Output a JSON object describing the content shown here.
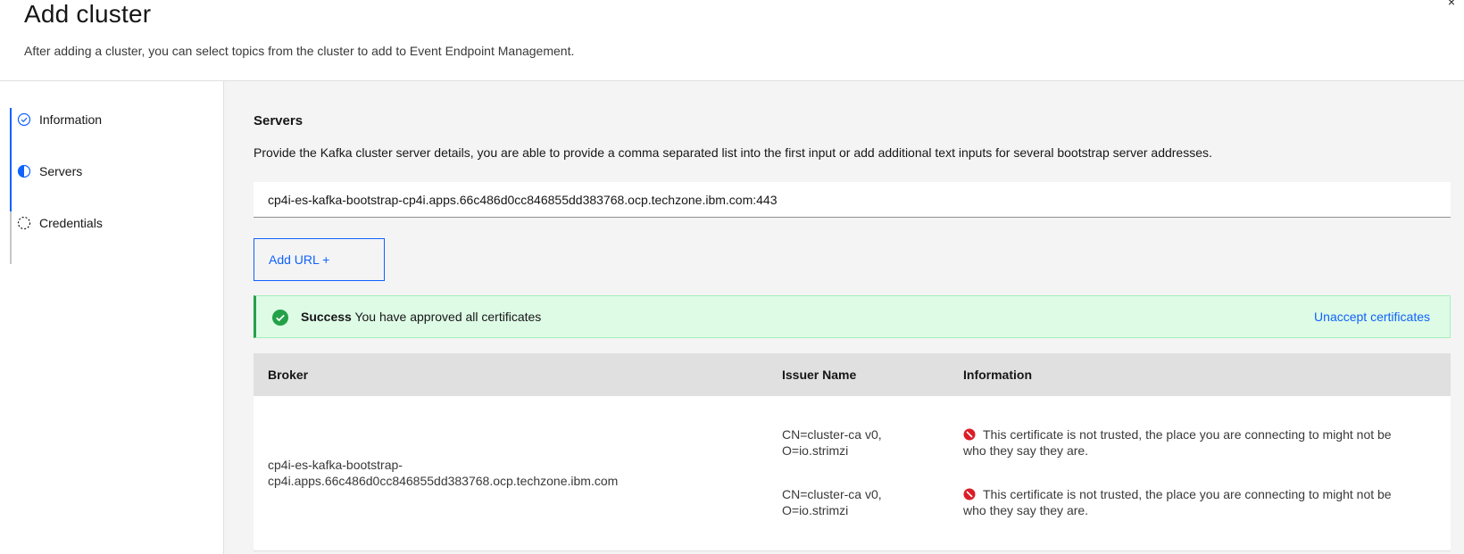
{
  "header": {
    "title": "Add cluster",
    "subtitle": "After adding a cluster, you can select topics from the cluster to add to Event Endpoint Management.",
    "close_symbol": "×"
  },
  "sidebar": {
    "steps": [
      {
        "label": "Information",
        "status": "complete",
        "icon": "checkmark-outline-icon"
      },
      {
        "label": "Servers",
        "status": "current",
        "icon": "incomplete-half-icon"
      },
      {
        "label": "Credentials",
        "status": "incomplete",
        "icon": "dashed-circle-icon"
      }
    ]
  },
  "servers": {
    "title": "Servers",
    "description": "Provide the Kafka cluster server details, you are able to provide a comma separated list into the first input or add additional text inputs for several bootstrap server addresses.",
    "url_value": "cp4i-es-kafka-bootstrap-cp4i.apps.66c486d0cc846855dd383768.ocp.techzone.ibm.com:443",
    "add_url_label": "Add URL +"
  },
  "notification": {
    "kind": "success",
    "title": "Success",
    "message": "You have approved all certificates",
    "action": "Unaccept certificates"
  },
  "table": {
    "headers": [
      "Broker",
      "Issuer Name",
      "Information"
    ],
    "rows": [
      {
        "broker_line1": "cp4i-es-kafka-bootstrap-",
        "broker_line2": "cp4i.apps.66c486d0cc846855dd383768.ocp.techzone.ibm.com",
        "certificates": [
          {
            "issuer_line1": "CN=cluster-ca v0,",
            "issuer_line2": "O=io.strimzi",
            "info_line1": "This certificate is not trusted, the place you are connecting to might not be",
            "info_line2": "who they say they are."
          },
          {
            "issuer_line1": "CN=cluster-ca v0,",
            "issuer_line2": "O=io.strimzi",
            "info_line1": "This certificate is not trusted, the place you are connecting to might not be",
            "info_line2": "who they say they are."
          }
        ]
      }
    ]
  },
  "colors": {
    "accent": "#0f62fe",
    "success": "#24a148",
    "success_bg": "#defbe6",
    "error": "#da1e28",
    "main_bg": "#f4f4f4"
  }
}
